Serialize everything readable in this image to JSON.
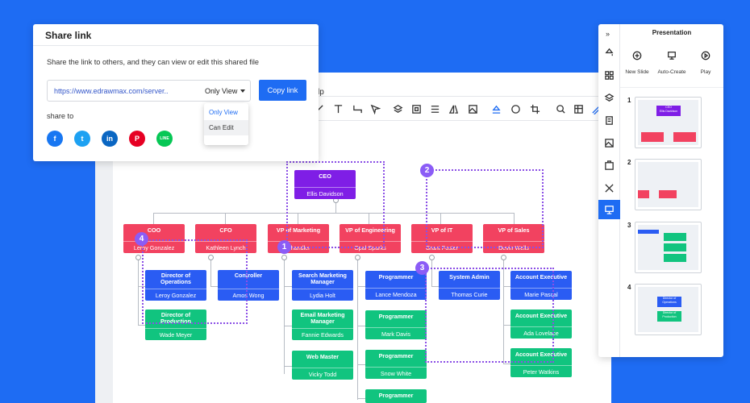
{
  "menu": {
    "help_fragment": "lp"
  },
  "share": {
    "title": "Share link",
    "description": "Share the link to others, and they can view or edit this shared file",
    "url": "https://www.edrawmax.com/server..",
    "permission": "Only View",
    "copy_label": "Copy link",
    "share_to_label": "share to",
    "options": [
      "Only View",
      "Can Edit"
    ],
    "socials": [
      {
        "name": "facebook",
        "glyph": "f",
        "color": "#1877f2"
      },
      {
        "name": "twitter",
        "glyph": "t",
        "color": "#1da1f2"
      },
      {
        "name": "linkedin",
        "glyph": "in",
        "color": "#0a66c2"
      },
      {
        "name": "pinterest",
        "glyph": "P",
        "color": "#e60023"
      },
      {
        "name": "line",
        "glyph": "LINE",
        "color": "#06c755"
      }
    ]
  },
  "org": {
    "ceo": {
      "title": "CEO",
      "name": "Ellis Davidson"
    },
    "vps": [
      {
        "title": "COO",
        "name": "Leroy Gonzalez"
      },
      {
        "title": "CFO",
        "name": "Kathleen Lynch"
      },
      {
        "title": "VP of Marketing",
        "name": "Chandler"
      },
      {
        "title": "VP of Engineering",
        "name": "Opal Sparks"
      },
      {
        "title": "VP of IT",
        "name": "Grant Foster"
      },
      {
        "title": "VP of Sales",
        "name": "Devin Wells"
      }
    ],
    "coo_reports": [
      {
        "title": "Director of Operations",
        "name": "Leroy Gonzalez"
      },
      {
        "title": "Director of Production",
        "name": "Wade Meyer"
      }
    ],
    "cfo_reports": [
      {
        "title": "Controller",
        "name": "Amos Wong"
      }
    ],
    "marketing_reports": [
      {
        "title": "Search Marketing Manager",
        "name": "Lydia Holt"
      },
      {
        "title": "Email Marketing Manager",
        "name": "Fannie Edwards"
      },
      {
        "title": "Web Master",
        "name": "Vicky Todd"
      }
    ],
    "engineering_reports": [
      {
        "title": "Programmer",
        "name": "Lance Mendoza"
      },
      {
        "title": "Programmer",
        "name": "Mark Davis"
      },
      {
        "title": "Programmer",
        "name": "Snow White"
      },
      {
        "title": "Programmer",
        "name": ""
      }
    ],
    "it_reports": [
      {
        "title": "System Admin",
        "name": "Thomas Curie"
      }
    ],
    "sales_reports": [
      {
        "title": "Account Executive",
        "name": "Marie Pascal"
      },
      {
        "title": "Account Executive",
        "name": "Ada Lovelace"
      },
      {
        "title": "Account Executive",
        "name": "Peter Watkins"
      }
    ],
    "badges": [
      "1",
      "2",
      "3",
      "4"
    ]
  },
  "presentation": {
    "title": "Presentation",
    "actions": [
      "New Slide",
      "Auto-Create",
      "Play"
    ],
    "slide_numbers": [
      "1",
      "2",
      "3",
      "4"
    ],
    "slide1": {
      "title": "CEO",
      "name": "Ellis Davidson"
    },
    "slide4": {
      "title": "Director of Operations",
      "name": "Director of Production"
    }
  },
  "colors": {
    "accent": "#1e6cf3",
    "purple": "#7f1ee6",
    "red": "#f24260",
    "blue": "#2a5cf3",
    "green": "#11c47f"
  }
}
